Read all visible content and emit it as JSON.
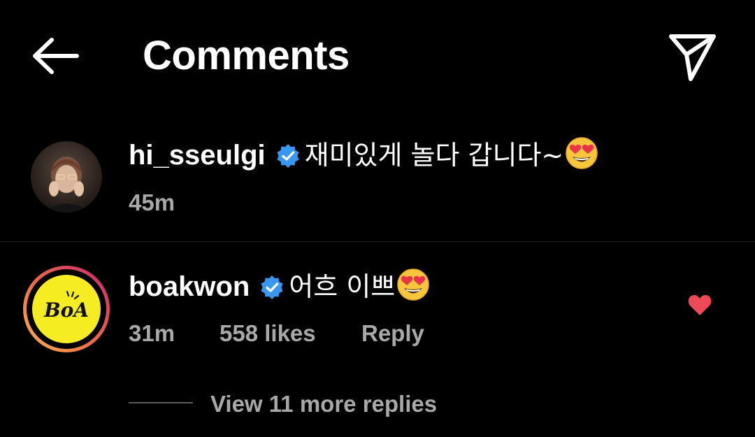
{
  "header": {
    "title": "Comments",
    "back_icon": "arrow-left-icon",
    "share_icon": "paper-plane-icon"
  },
  "comments": [
    {
      "username": "hi_sseulgi",
      "verified": true,
      "text": "재미있게 놀다 갑니다~",
      "emoji": "heart-eyes-emoji",
      "time": "45m"
    },
    {
      "username": "boakwon",
      "verified": true,
      "text": "어흐 이쁘",
      "emoji": "heart-eyes-emoji",
      "time": "31m",
      "likes": "558 likes",
      "reply_label": "Reply",
      "liked": true,
      "avatar_logo_text": "BoA",
      "view_replies": "View 11 more replies"
    }
  ],
  "colors": {
    "background": "#000000",
    "meta_text": "#a8a8a8",
    "verified_blue": "#3897f0",
    "like_red": "#ed4956",
    "avatar_yellow": "#f6ec22"
  }
}
